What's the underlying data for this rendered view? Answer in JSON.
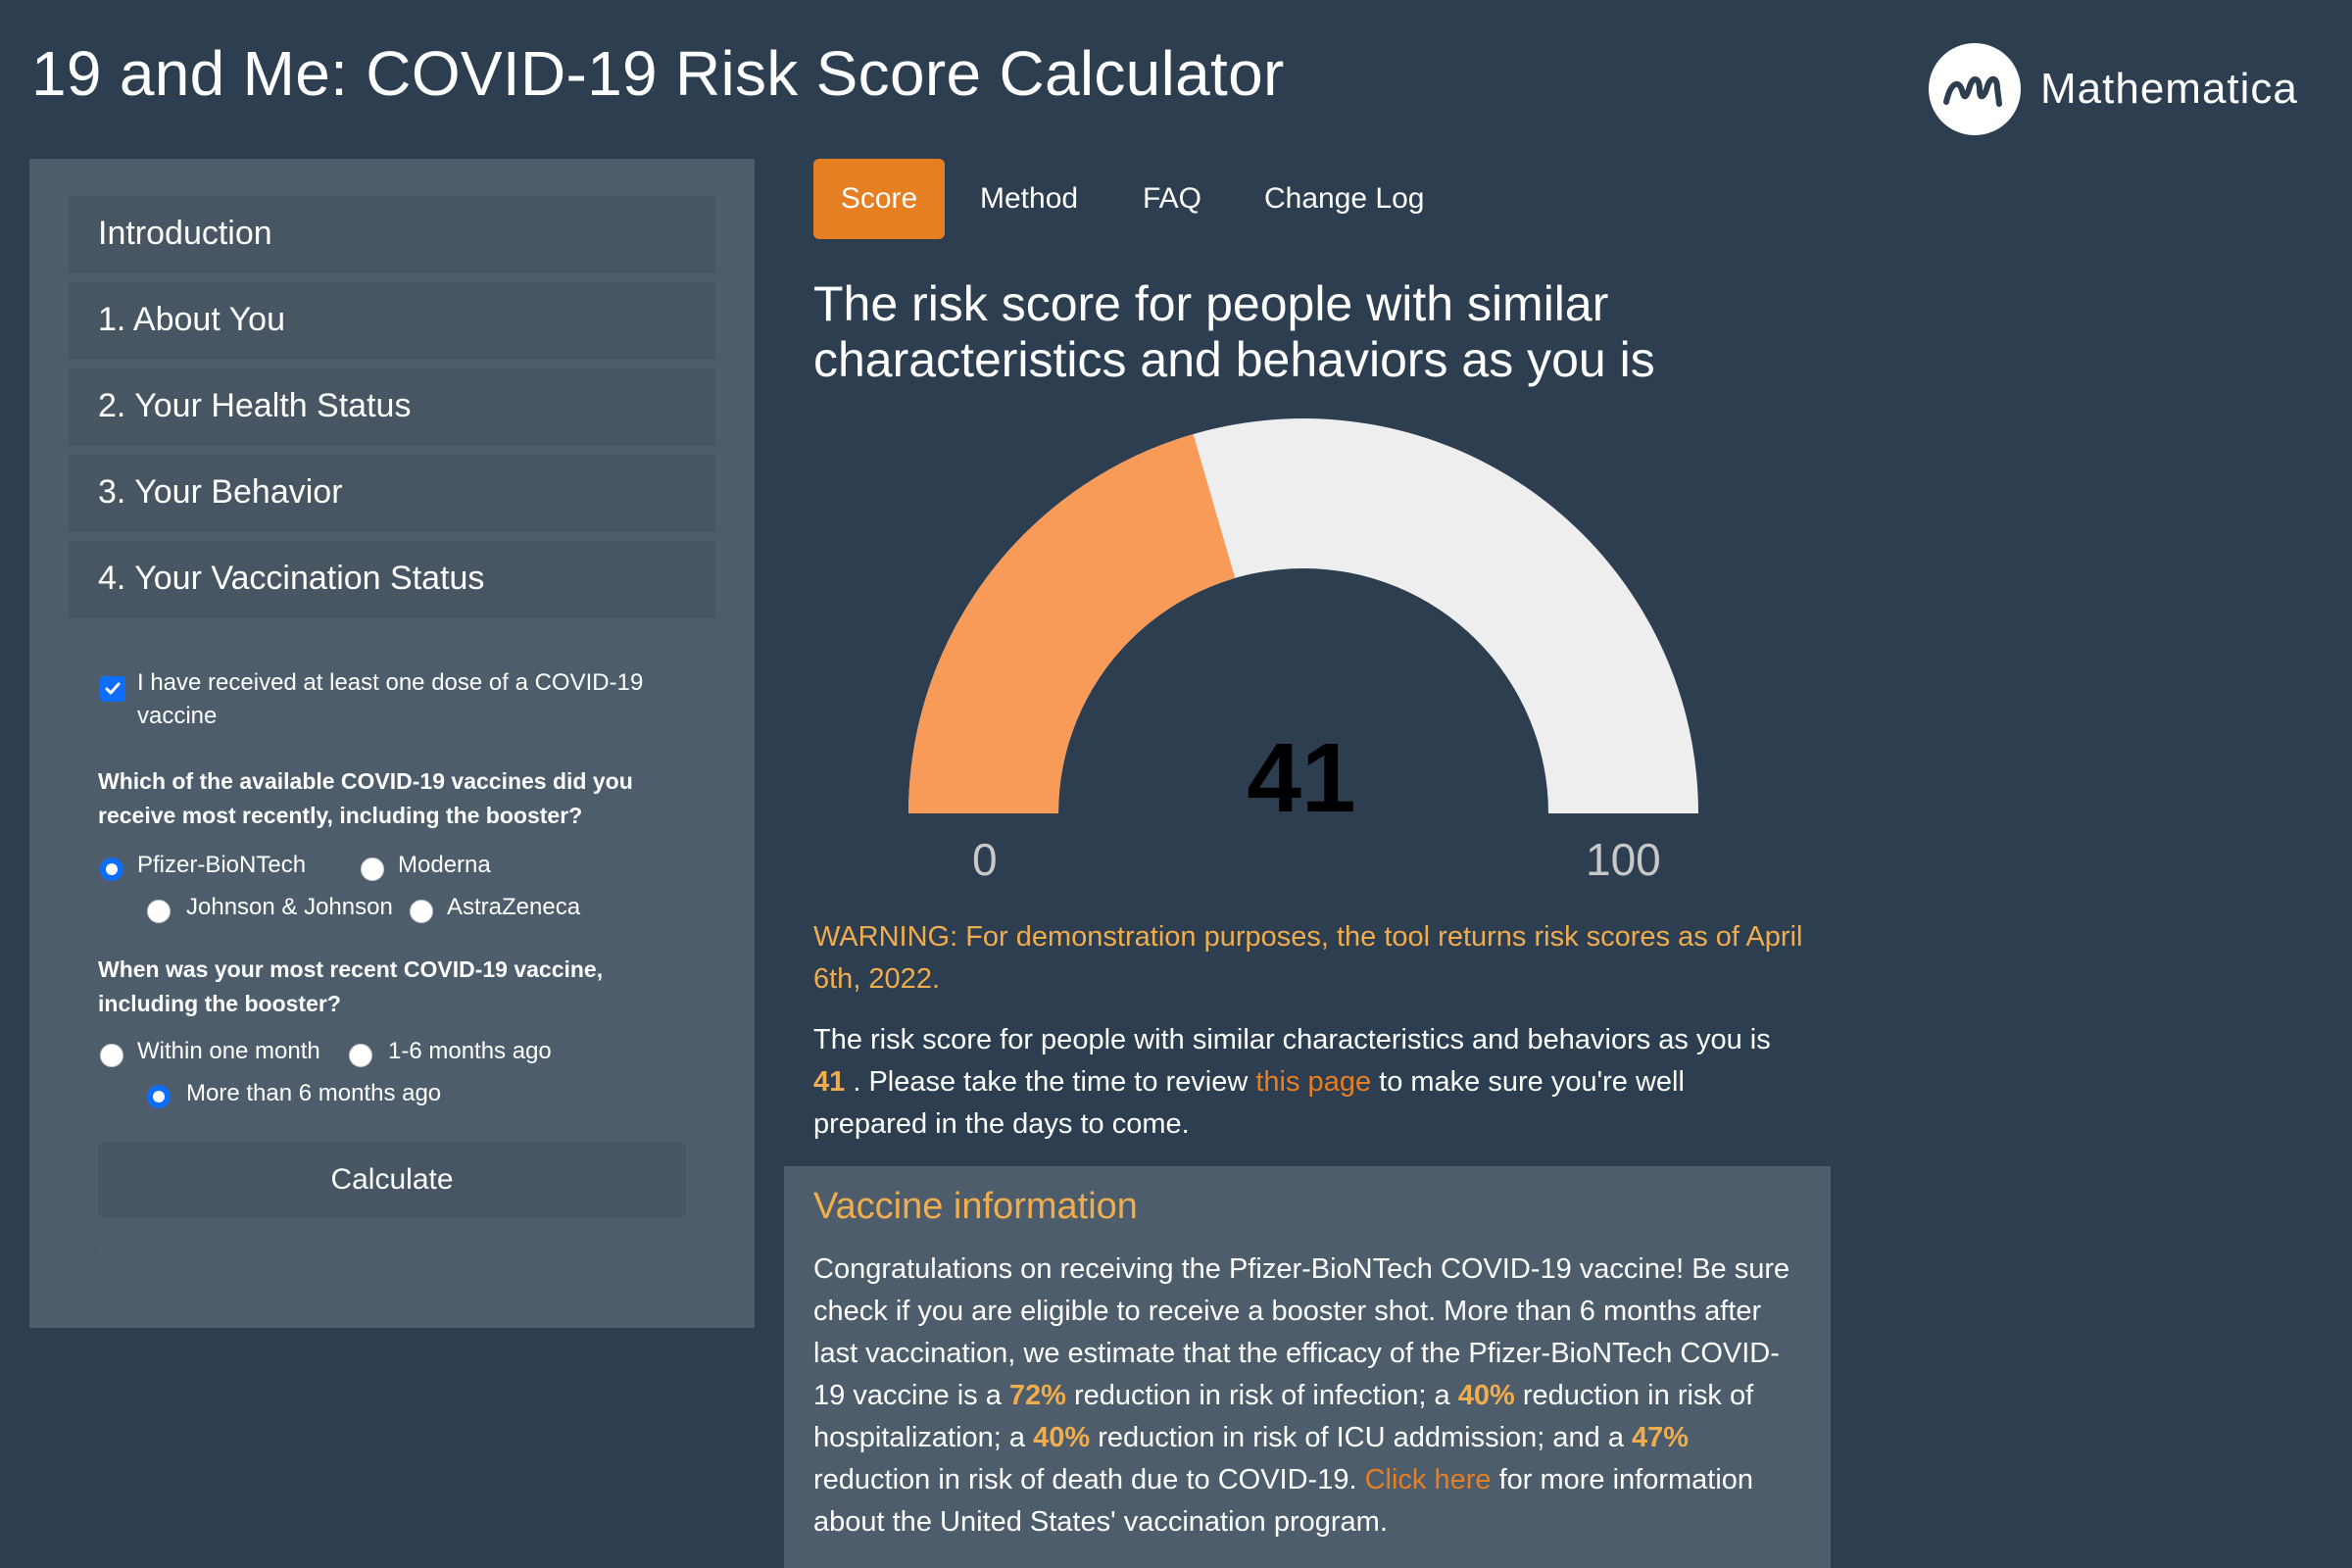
{
  "header": {
    "title": "19 and Me: COVID-19 Risk Score Calculator",
    "logo_text": "Mathematica"
  },
  "sidebar": {
    "sections": [
      {
        "label": "Introduction"
      },
      {
        "label": "1. About You"
      },
      {
        "label": "2. Your Health Status"
      },
      {
        "label": "3. Your Behavior"
      },
      {
        "label": "4. Your Vaccination Status"
      }
    ],
    "vaccinated_checkbox": {
      "label": "I have received at least one dose of a COVID-19 vaccine",
      "checked": true
    },
    "vaccine_question": "Which of the available COVID-19 vaccines did you receive most recently, including the booster?",
    "vaccine_options": [
      {
        "label": "Pfizer-BioNTech",
        "selected": true
      },
      {
        "label": "Moderna",
        "selected": false
      },
      {
        "label": "Johnson & Johnson",
        "selected": false
      },
      {
        "label": "AstraZeneca",
        "selected": false
      }
    ],
    "timing_question": "When was your most recent COVID-19 vaccine, including the booster?",
    "timing_options": [
      {
        "label": "Within one month",
        "selected": false
      },
      {
        "label": "1-6 months ago",
        "selected": false
      },
      {
        "label": "More than 6 months ago",
        "selected": true
      }
    ],
    "calculate_label": "Calculate"
  },
  "tabs": [
    {
      "label": "Score",
      "active": true
    },
    {
      "label": "Method",
      "active": false
    },
    {
      "label": "FAQ",
      "active": false
    },
    {
      "label": "Change Log",
      "active": false
    }
  ],
  "score": {
    "heading": "The risk score for people with similar characteristics and behaviors as you is",
    "value": "41",
    "gauge_value": 41,
    "gauge_min": "0",
    "gauge_max": "100",
    "fill_color": "#f89a58",
    "track_color": "#efeeef",
    "warning": "WARNING: For demonstration purposes, the tool returns risk scores as of April 6th, 2022.",
    "para_prefix": "The risk score for people with similar characteristics and behaviors as you is",
    "para_value": "41",
    "para_mid": ". Please take the time to review",
    "para_link": "this page",
    "para_suffix": "to make sure you're well prepared in the days to come."
  },
  "vaccine_info": {
    "title": "Vaccine information",
    "t1": "Congratulations on receiving the Pfizer-BioNTech COVID-19 vaccine! Be sure check if you are eligible to receive a booster shot. More than 6 months after last vaccination, we estimate that the efficacy of the Pfizer-BioNTech COVID-19 vaccine is a",
    "p1": "72%",
    "t2": "reduction in risk of infection; a",
    "p2": "40%",
    "t3": "reduction in risk of hospitalization; a",
    "p3": "40%",
    "t4": "reduction in risk of ICU addmission; and a",
    "p4": "47%",
    "t5": "reduction in risk of death due to COVID-19.",
    "link": "Click here",
    "t6": "for more information about the United States' vaccination program."
  },
  "colors": {
    "background": "#2c3e50",
    "panel": "#4e5d6c",
    "accent": "#e67e22",
    "highlight": "#f0ad4e"
  }
}
